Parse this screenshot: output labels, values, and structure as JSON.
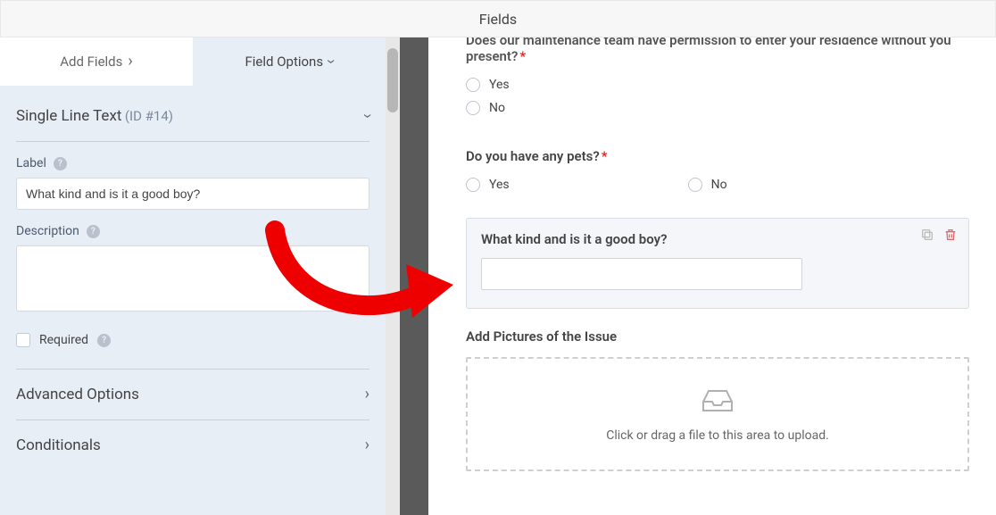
{
  "header": {
    "title": "Fields"
  },
  "tabs": {
    "add_fields": "Add Fields",
    "field_options": "Field Options"
  },
  "panel": {
    "type_label": "Single Line Text",
    "id_label": "(ID #14)",
    "label_title": "Label",
    "label_value": "What kind and is it a good boy?",
    "description_title": "Description",
    "description_value": "",
    "required_label": "Required",
    "advanced_title": "Advanced Options",
    "conditionals_title": "Conditionals"
  },
  "preview": {
    "q1_label": "Does our maintenance team have permission to enter your residence without you present?",
    "q2_label": "Do you have any pets?",
    "yes": "Yes",
    "no": "No",
    "selected_label": "What kind and is it a good boy?",
    "upload_label": "Add Pictures of the Issue",
    "dropzone_text": "Click or drag a file to this area to upload."
  }
}
